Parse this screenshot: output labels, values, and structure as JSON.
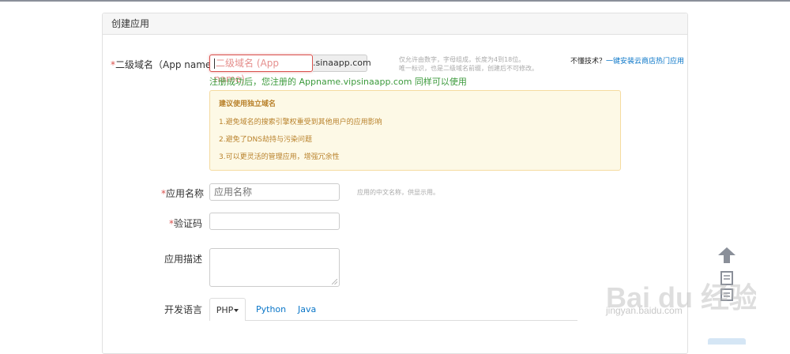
{
  "panel": {
    "title": "创建应用"
  },
  "form": {
    "domain": {
      "required_mark": "*",
      "label": "二级域名（App name)",
      "placeholder": "二级域名 (App name)",
      "suffix": ".sinaapp.com",
      "hint_line1": "仅允许由数字，字母组成，长度为4到18位。",
      "hint_line2": "唯一标识，也是二级域名前缀，创建后不可修改。",
      "success_msg": "注册成功后，您注册的 Appname.vipsinaapp.com 同样可以使用"
    },
    "help": {
      "prefix": "不懂技术？",
      "link": "一键安装云商店热门应用"
    },
    "advice": {
      "title": "建议使用独立域名",
      "items": [
        "1.避免域名的搜索引擎权重受到其他用户的应用影响",
        "2.避免了DNS劫持与污染问题",
        "3.可以更灵活的管理应用，增强冗余性"
      ]
    },
    "app_name": {
      "required_mark": "*",
      "label": "应用名称",
      "placeholder": "应用名称",
      "hint": "应用的中文名称，供显示用。"
    },
    "captcha": {
      "required_mark": "*",
      "label": "验证码"
    },
    "description": {
      "label": "应用描述"
    },
    "language": {
      "label": "开发语言",
      "tabs": [
        "PHP",
        "Python",
        "Java"
      ]
    }
  },
  "icons": {
    "scroll_top": "arrow-up-icon",
    "feedback": "document-icon",
    "dropdown": "caret-down-icon"
  },
  "watermark": {
    "brand": "Bai du 经验",
    "url": "jingyan.baidu.com"
  },
  "colors": {
    "accent_link": "#0a76c8",
    "required": "#d9534f",
    "success": "#3c9a3c",
    "advice_bg": "#fdf9e6",
    "advice_text": "#b9822c"
  }
}
